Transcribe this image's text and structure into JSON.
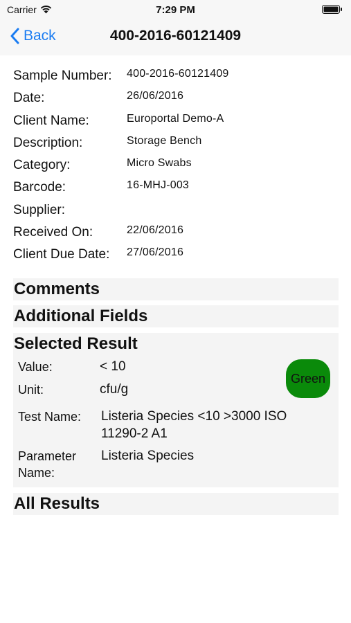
{
  "status_bar": {
    "carrier": "Carrier",
    "time": "7:29 PM"
  },
  "nav": {
    "back_label": "Back",
    "title": "400-2016-60121409"
  },
  "details": [
    {
      "label": "Sample Number:",
      "value": "400-2016-60121409"
    },
    {
      "label": "Date:",
      "value": "26/06/2016"
    },
    {
      "label": "Client Name:",
      "value": "Europortal Demo-A"
    },
    {
      "label": "Description:",
      "value": "Storage Bench"
    },
    {
      "label": "Category:",
      "value": "Micro Swabs"
    },
    {
      "label": "Barcode:",
      "value": "16-MHJ-003"
    },
    {
      "label": "Supplier:",
      "value": ""
    },
    {
      "label": "Received On:",
      "value": "22/06/2016"
    },
    {
      "label": "Client Due Date:",
      "value": "27/06/2016"
    }
  ],
  "sections": {
    "comments": "Comments",
    "additional_fields": "Additional Fields",
    "selected_result": "Selected Result",
    "all_results": "All Results"
  },
  "selected_result": {
    "value_label": "Value:",
    "value": "< 10",
    "unit_label": "Unit:",
    "unit": "cfu/g",
    "test_name_label": "Test Name:",
    "test_name_line1": "Listeria Species <10 >3000 ISO",
    "test_name_line2": "11290-2 A1",
    "parameter_label_line1": "Parameter",
    "parameter_label_line2": "Name:",
    "parameter_name": "Listeria Species",
    "status_button": "Green"
  },
  "colors": {
    "accent": "#1a7cf2",
    "status_green": "#0a8a0a",
    "section_bg": "#f4f4f4"
  },
  "icons": {
    "signal": "wifi-icon",
    "battery": "battery-icon",
    "back": "chevron-left-icon"
  }
}
